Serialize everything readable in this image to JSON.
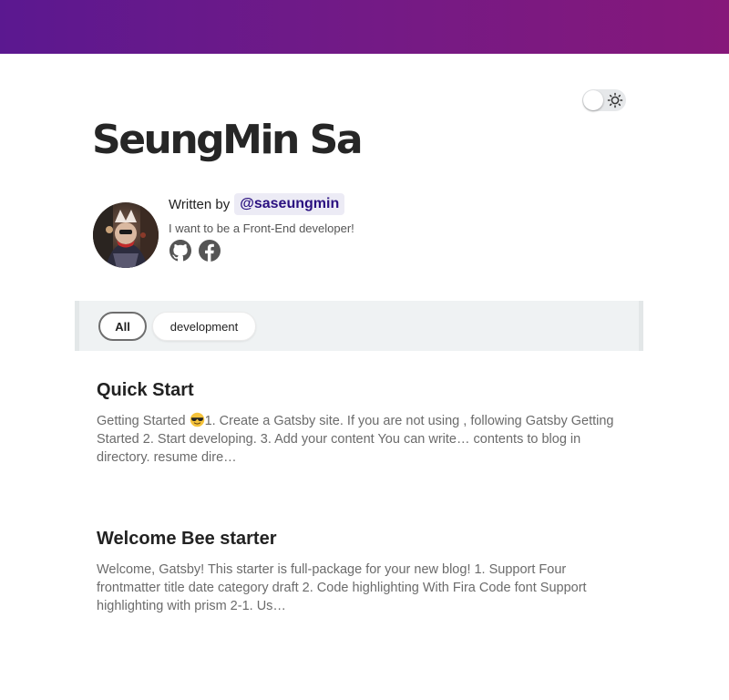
{
  "header": {
    "gradient_start": "#5b1890",
    "gradient_end": "#86187a"
  },
  "theme_toggle": {
    "state": "light",
    "icon": "sun-icon"
  },
  "site": {
    "title": "SeungMin Sa"
  },
  "bio": {
    "written_by_label": "Written by",
    "author_handle": "@saseungmin",
    "description": "I want to be a Front-End developer!",
    "social_icons": [
      "github-icon",
      "facebook-icon"
    ]
  },
  "categories": {
    "items": [
      {
        "label": "All",
        "selected": true
      },
      {
        "label": "development",
        "selected": false
      }
    ]
  },
  "posts": [
    {
      "title": "Quick Start",
      "excerpt_prefix": "Getting Started ",
      "excerpt_emoji": "smiling-face-with-sunglasses",
      "excerpt_rest": "1. Create a Gatsby site. If you are not using , following Gatsby Getting Started 2. Start developing. 3. Add your content You can write… contents to blog in directory. resume dire…"
    },
    {
      "title": "Welcome Bee starter",
      "excerpt": "Welcome, Gatsby! This starter is full-package for your new blog! 1. Support Four frontmatter title date category draft 2. Code highlighting With Fira Code font Support highlighting with prism 2-1. Us…"
    }
  ]
}
